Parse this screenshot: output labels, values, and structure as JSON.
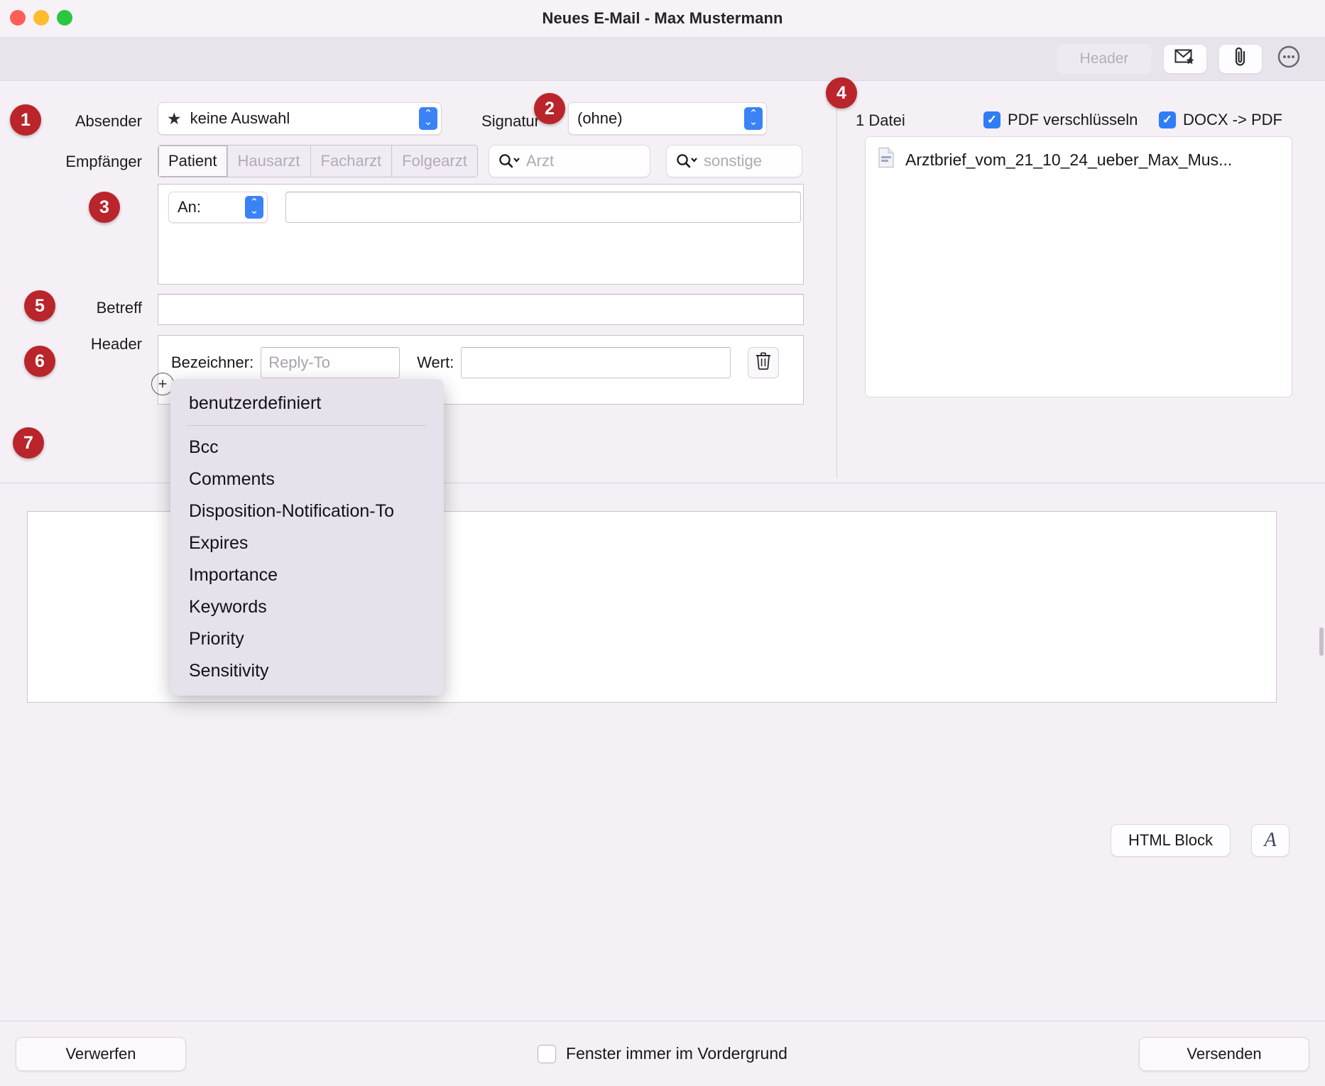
{
  "window": {
    "title": "Neues E-Mail - Max Mustermann"
  },
  "toolbar": {
    "header_button": "Header",
    "mail_icon": "mail-star-icon",
    "attach_icon": "paperclip-icon",
    "more_icon": "more-circle-icon"
  },
  "badges": {
    "one": "1",
    "two": "2",
    "three": "3",
    "four": "4",
    "five": "5",
    "six": "6",
    "seven": "7"
  },
  "sender": {
    "label": "Absender",
    "value": "keine Auswahl",
    "star_icon": "star-icon"
  },
  "signature": {
    "label": "Signatur",
    "value": "(ohne)"
  },
  "recipients": {
    "label": "Empfänger",
    "tabs": [
      {
        "label": "Patient",
        "active": true
      },
      {
        "label": "Hausarzt",
        "active": false
      },
      {
        "label": "Facharzt",
        "active": false
      },
      {
        "label": "Folgearzt",
        "active": false
      }
    ],
    "search_doctor_placeholder": "Arzt",
    "search_other_placeholder": "sonstige",
    "search_icon": "search-icon",
    "to_select_value": "An:",
    "to_value": ""
  },
  "subject": {
    "label": "Betreff",
    "value": ""
  },
  "header_section": {
    "label": "Header",
    "key_label": "Bezeichner:",
    "key_placeholder": "Reply-To",
    "key_value": "",
    "value_label": "Wert:",
    "value_value": "",
    "delete_icon": "trash-icon",
    "add_icon": "plus-circle-icon"
  },
  "header_menu": {
    "items": [
      "benutzerdefiniert",
      "Bcc",
      "Comments",
      "Disposition-Notification-To",
      "Expires",
      "Importance",
      "Keywords",
      "Priority",
      "Sensitivity"
    ],
    "separator_after_index": 0
  },
  "attachments": {
    "count_label": "1 Datei",
    "encrypt_pdf_label": "PDF verschlüsseln",
    "encrypt_pdf_checked": true,
    "docx_to_pdf_label": "DOCX -> PDF",
    "docx_to_pdf_checked": true,
    "files": [
      {
        "name": "Arztbrief_vom_21_10_24_ueber_Max_Mus...",
        "icon": "document-icon"
      }
    ]
  },
  "editor": {
    "content": "",
    "html_block_label": "HTML Block",
    "font_button_icon": "font-format-icon",
    "font_button_glyph": "A"
  },
  "footer": {
    "discard_label": "Verwerfen",
    "always_front_label": "Fenster immer im Vordergrund",
    "always_front_checked": false,
    "send_label": "Versenden"
  },
  "colors": {
    "badge": "#b9252b",
    "accent_blue": "#2f7df6",
    "window_bg": "#f4f0f5"
  }
}
